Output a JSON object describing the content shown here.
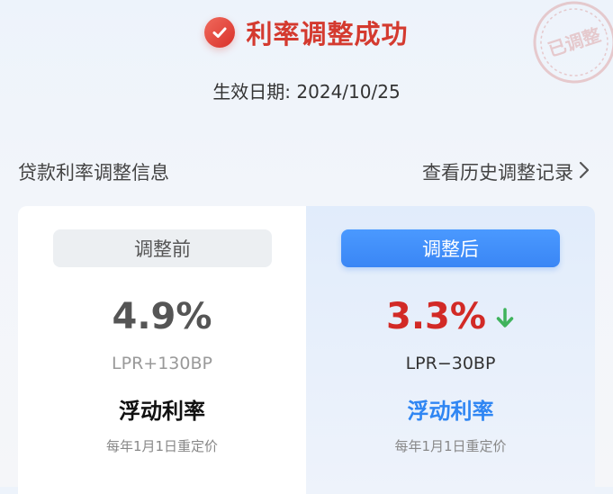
{
  "header": {
    "title": "利率调整成功",
    "stamp_text": "已调整"
  },
  "effective_date": "生效日期: 2024/10/25",
  "section": {
    "title": "贷款利率调整信息",
    "history_link": "查看历史调整记录"
  },
  "before": {
    "label": "调整前",
    "rate": "4.9%",
    "formula": "LPR+130BP",
    "rate_type": "浮动利率",
    "reprice": "每年1月1日重定价"
  },
  "after": {
    "label": "调整后",
    "rate": "3.3%",
    "formula": "LPR−30BP",
    "rate_type": "浮动利率",
    "reprice": "每年1月1日重定价"
  },
  "colors": {
    "accent_red": "#d43a2f",
    "accent_blue": "#3a86f5",
    "down_arrow_green": "#3fb35c"
  },
  "icons": {
    "success": "check-circle-icon",
    "link_arrow": "chevron-right-icon",
    "trend": "arrow-down-icon"
  }
}
